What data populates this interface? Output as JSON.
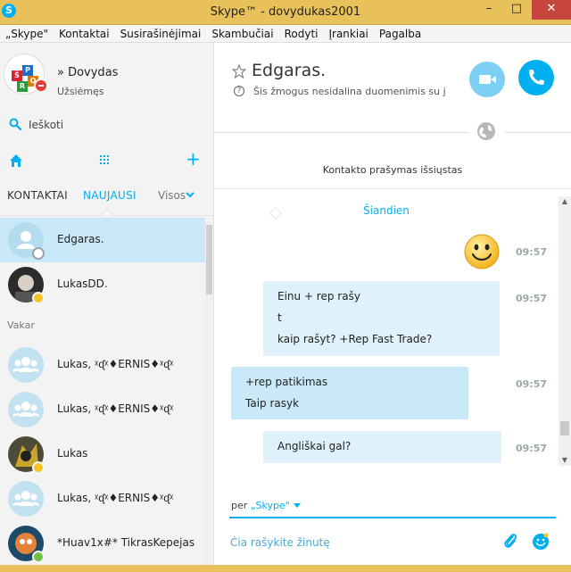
{
  "window": {
    "title": "Skype™ - dovydukas2001",
    "app_icon_letter": "S",
    "minimize": "–",
    "maximize": "□",
    "close": "✕"
  },
  "menu": [
    "„Skype\"",
    "Kontaktai",
    "Susirašinėjimai",
    "Skambučiai",
    "Rodyti",
    "Įrankiai",
    "Pagalba"
  ],
  "profile": {
    "name": "» Dovydas",
    "status": "Užsiėmęs",
    "avatar_tiles": [
      "Š",
      "P",
      "O",
      "R"
    ]
  },
  "search": {
    "placeholder": "Ieškoti"
  },
  "tabs": {
    "contacts": "KONTAKTAI",
    "recent": "NAUJAUSI",
    "filter": "Visos"
  },
  "contacts_list": {
    "section_yesterday": "Vakar",
    "items": [
      {
        "name": "Edgaras.",
        "status": "unknown"
      },
      {
        "name": "LukasDD.",
        "status": "away"
      },
      {
        "name": "Lukas, ᵡᶑᵡ♦ERNIS♦ᵡᶑᵡ",
        "status": "none"
      },
      {
        "name": "Lukas, ᵡᶑᵡ♦ERNIS♦ᵡᶑᵡ",
        "status": "none"
      },
      {
        "name": "Lukas",
        "status": "away"
      },
      {
        "name": "Lukas, ᵡᶑᵡ♦ERNIS♦ᵡᶑᵡ",
        "status": "none"
      },
      {
        "name": "*Huav1x#* TikrasKepejas",
        "status": "online"
      }
    ]
  },
  "chat": {
    "title": "Edgaras.",
    "subtitle": "Šis žmogus nesidalina duomenimis su j...",
    "request_note": "Kontakto prašymas išsiųstas",
    "day_label": "Šiandien",
    "messages": [
      {
        "type": "emoji",
        "time": "09:57"
      },
      {
        "type": "out",
        "lines": [
          "Einu + rep rašy",
          "t",
          "kaip rašyt? +Rep Fast Trade?"
        ],
        "time": "09:57"
      },
      {
        "type": "in",
        "lines": [
          "+rep patikimas",
          "Taip rasyk"
        ],
        "time": "09:57"
      },
      {
        "type": "out",
        "lines": [
          "Angliškai gal?"
        ],
        "time": "09:57"
      }
    ],
    "via_prefix": "per",
    "via_service": "„Skype\"",
    "compose_placeholder": "Čia rašykite žinutę"
  },
  "colors": {
    "accent": "#00aff0",
    "titlebar": "#e8c15a",
    "selected_row": "#c9e9f8",
    "bubble_out": "#dff1fb",
    "bubble_in": "#c9e9f8",
    "status_dnd": "#e53935",
    "status_away": "#f6c324",
    "status_online": "#71bf44"
  }
}
